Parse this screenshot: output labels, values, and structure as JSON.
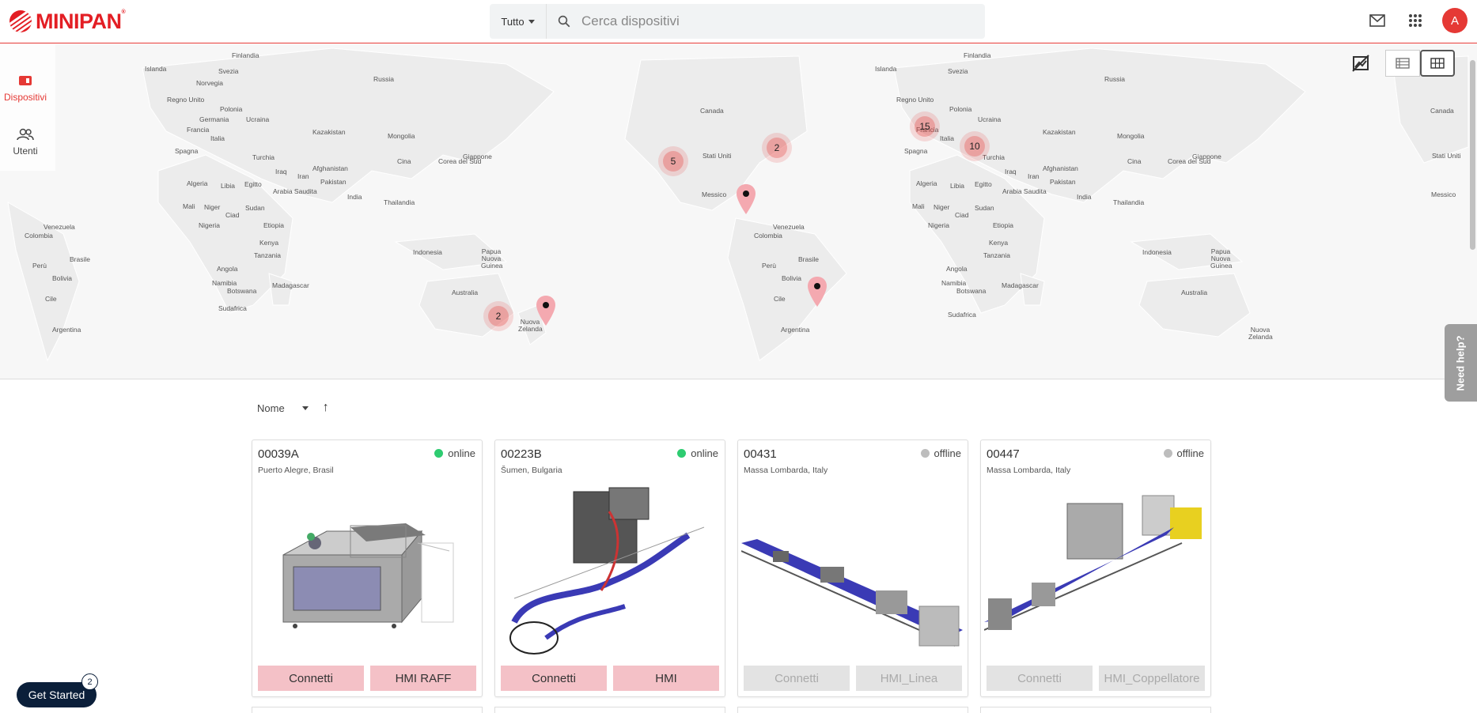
{
  "brand": {
    "name": "MINIPAN",
    "accent": "#e31e24"
  },
  "search": {
    "scope": "Tutto",
    "placeholder": "Cerca dispositivi"
  },
  "header": {
    "avatar_letter": "A"
  },
  "sidebar": {
    "items": [
      {
        "label": "Dispositivi",
        "icon": "devices-icon"
      },
      {
        "label": "Utenti",
        "icon": "users-icon"
      }
    ]
  },
  "map_labels": [
    "Finlandia",
    "Islanda",
    "Svezia",
    "Norvegia",
    "Russia",
    "Regno Unito",
    "Polonia",
    "Germania",
    "Ucraina",
    "Francia",
    "Italia",
    "Kazakistan",
    "Mongolia",
    "Spagna",
    "Turchia",
    "Iraq",
    "Iran",
    "Afghanistan",
    "Pakistan",
    "Cina",
    "Corea del Sud",
    "Giappone",
    "Algeria",
    "Libia",
    "Egitto",
    "Arabia Saudita",
    "India",
    "Thailandia",
    "Mali",
    "Niger",
    "Sudan",
    "Ciad",
    "Nigeria",
    "Etiopia",
    "Kenya",
    "Tanzania",
    "Angola",
    "Namibia",
    "Botswana",
    "Madagascar",
    "Sudafrica",
    "Indonesia",
    "Papua Nuova Guinea",
    "Australia",
    "Nuova Zelanda",
    "Canada",
    "Stati Uniti",
    "Messico",
    "Venezuela",
    "Colombia",
    "Brasile",
    "Perù",
    "Bolivia",
    "Cile",
    "Argentina"
  ],
  "clusters": [
    {
      "label": "5"
    },
    {
      "label": "2"
    },
    {
      "label": "2"
    },
    {
      "label": "15"
    },
    {
      "label": "10"
    }
  ],
  "need_help": "Need help?",
  "sort": {
    "label": "Nome"
  },
  "devices": [
    {
      "id": "00039A",
      "status": "online",
      "location": "Puerto Alegre, Brasil",
      "buttons": [
        "Connetti",
        "HMI RAFF"
      ]
    },
    {
      "id": "00223B",
      "status": "online",
      "location": "Šumen, Bulgaria",
      "buttons": [
        "Connetti",
        "HMI"
      ]
    },
    {
      "id": "00431",
      "status": "offline",
      "location": "Massa Lombarda, Italy",
      "buttons": [
        "Connetti",
        "HMI_Linea"
      ]
    },
    {
      "id": "00447",
      "status": "offline",
      "location": "Massa Lombarda, Italy",
      "buttons": [
        "Connetti",
        "HMI_Coppellatore"
      ]
    }
  ],
  "status_colors": {
    "online": "#2ecc71",
    "offline": "#bdbdbd"
  },
  "get_started": {
    "label": "Get Started",
    "badge": "2"
  }
}
